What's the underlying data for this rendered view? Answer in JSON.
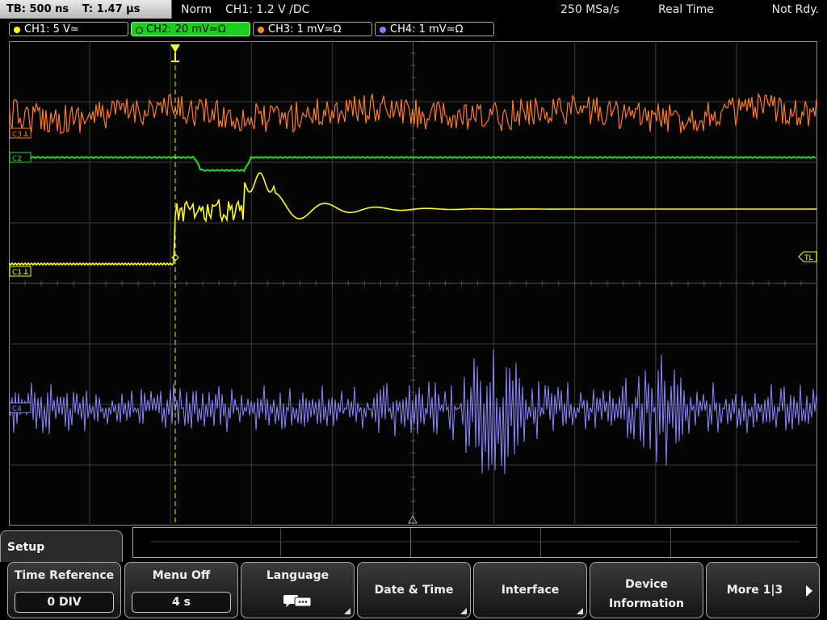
{
  "status": {
    "timebase": "TB: 500 ns",
    "trigger_time": "T: 1.47 µs",
    "mode": "Norm",
    "trigger": "CH1: 1.2 V ∕DC",
    "sample_rate": "250 MSa/s",
    "acquisition": "Real Time",
    "ready": "Not Rdy."
  },
  "channels": [
    {
      "label": "CH1: 5 V≃",
      "color": "#ffff00",
      "active": false
    },
    {
      "label": "CH2: 20 mV≃Ω",
      "color": "#1ccf1c",
      "active": true
    },
    {
      "label": "CH3: 1 mV≃Ω",
      "color": "#ff8a2a",
      "active": false
    },
    {
      "label": "CH4: 1 mV≃Ω",
      "color": "#8080ff",
      "active": false
    }
  ],
  "markers": {
    "c3": "C3",
    "c2": "C2",
    "c1": "C1",
    "c4": "C4",
    "trigger_level": "TL"
  },
  "menu": {
    "title": "Setup",
    "keys": [
      {
        "label": "Time Reference",
        "value": "0 DIV"
      },
      {
        "label": "Menu Off",
        "value": "4 s"
      },
      {
        "label": "Language",
        "icon": "speech-bubbles-icon"
      },
      {
        "label": "Date & Time"
      },
      {
        "label": "Interface"
      },
      {
        "label": "Device",
        "label2": "Information"
      },
      {
        "label": "More 1|3"
      }
    ]
  },
  "colors": {
    "ch1": "#ffff00",
    "ch2": "#22dd22",
    "ch3": "#ff7a20",
    "ch4": "#8a86ff",
    "grid": "#3a3a3a"
  }
}
